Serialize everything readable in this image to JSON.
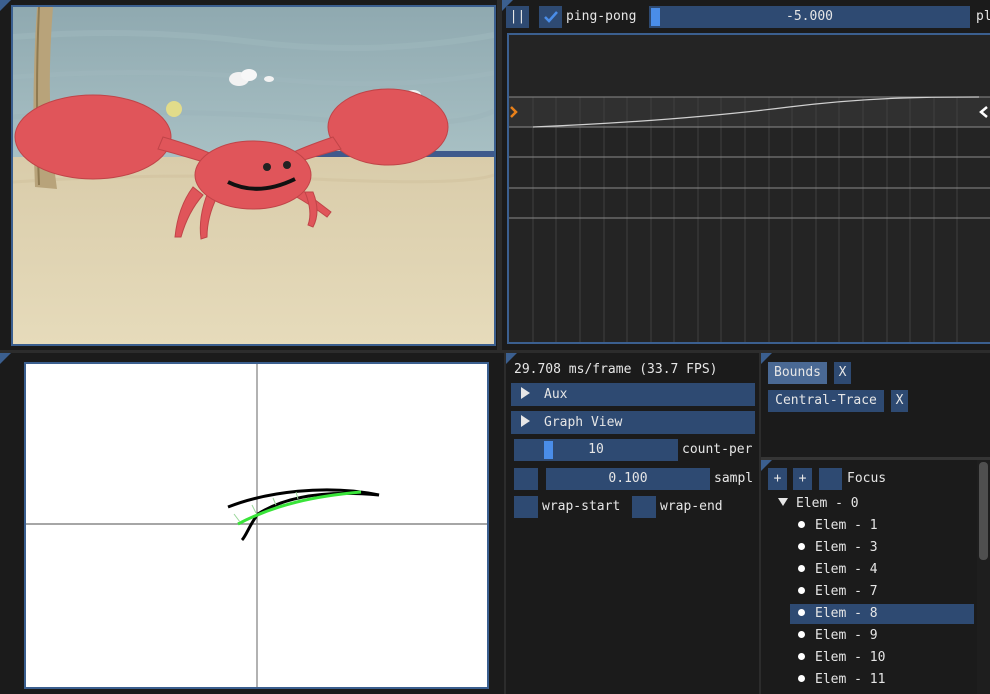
{
  "toolbar": {
    "pause_label": "||",
    "pingpong_label": "ping-pong",
    "pingpong_checked": true,
    "slider_value": "-5.000",
    "slider_fraction": 0.0,
    "cut_label": "pl"
  },
  "stats": {
    "fps_text": "29.708 ms/frame (33.7 FPS)"
  },
  "sections": {
    "aux_label": "Aux",
    "graph_view_label": "Graph View"
  },
  "controls": {
    "count_value": "10",
    "count_label": "count-per",
    "count_fraction": 0.2,
    "sample_value": "0.100",
    "sample_label": "sampl",
    "wrap_start_label": "wrap-start",
    "wrap_end_label": "wrap-end"
  },
  "tags": [
    {
      "label": "Bounds",
      "close": "X"
    },
    {
      "label": "Central-Trace",
      "close": "X"
    }
  ],
  "tree": {
    "add1": "+",
    "add2": "+",
    "focus_label": "Focus",
    "root": "Elem - 0",
    "items": [
      "Elem - 1",
      "Elem - 3",
      "Elem - 4",
      "Elem - 7",
      "Elem - 8",
      "Elem - 9",
      "Elem - 10",
      "Elem - 11"
    ],
    "selected_index": 4
  },
  "colors": {
    "accent": "#4a8de8",
    "panel_border": "#3b5f8f",
    "button": "#2e4a72",
    "selected": "#2e4a72",
    "curve_orange": "#e8801a"
  }
}
